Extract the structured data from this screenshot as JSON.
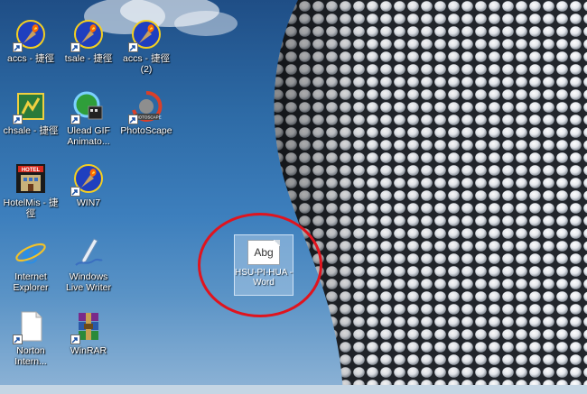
{
  "desktop": {
    "icons": [
      {
        "id": "accs",
        "label": "accs - 捷徑",
        "icon": "torch-icon",
        "shortcut": true
      },
      {
        "id": "tsale",
        "label": "tsale - 捷徑",
        "icon": "torch-icon",
        "shortcut": true
      },
      {
        "id": "accs2",
        "label": "accs - 捷徑 (2)",
        "icon": "torch-icon",
        "shortcut": true
      },
      {
        "id": "chsale",
        "label": "chsale - 捷徑",
        "icon": "chart-app-icon",
        "shortcut": true
      },
      {
        "id": "ulead",
        "label": "Ulead GIF Animato...",
        "icon": "ulead-gif-icon",
        "shortcut": true
      },
      {
        "id": "photoscape",
        "label": "PhotoScape",
        "icon": "photoscape-icon",
        "shortcut": true
      },
      {
        "id": "hotelmis",
        "label": "HotelMis - 捷徑",
        "icon": "hotel-icon",
        "shortcut": false
      },
      {
        "id": "win7",
        "label": "WIN7",
        "icon": "torch-icon",
        "shortcut": true
      },
      {
        "id": "ie",
        "label": "Internet Explorer",
        "icon": "internet-explorer-icon",
        "shortcut": false
      },
      {
        "id": "livewriter",
        "label": "Windows Live Writer",
        "icon": "live-writer-icon",
        "shortcut": false
      },
      {
        "id": "norton",
        "label": "Norton Intern...",
        "icon": "blank-document-icon",
        "shortcut": true
      },
      {
        "id": "winrar",
        "label": "WinRAR",
        "icon": "winrar-icon",
        "shortcut": true
      }
    ],
    "selected_file": {
      "preview_text": "Abg",
      "label": "HSU-PI-HUA -Word",
      "icon": "word-document-icon",
      "highlight_color": "#e0141e"
    },
    "hotel_sign": "HOTEL",
    "photoscape_badge": "PHOTOSCAPE",
    "accent_colors": {
      "sky_top": "#1f4e86",
      "sky_bottom": "#8fb4d6",
      "label_text": "#ffffff"
    }
  }
}
